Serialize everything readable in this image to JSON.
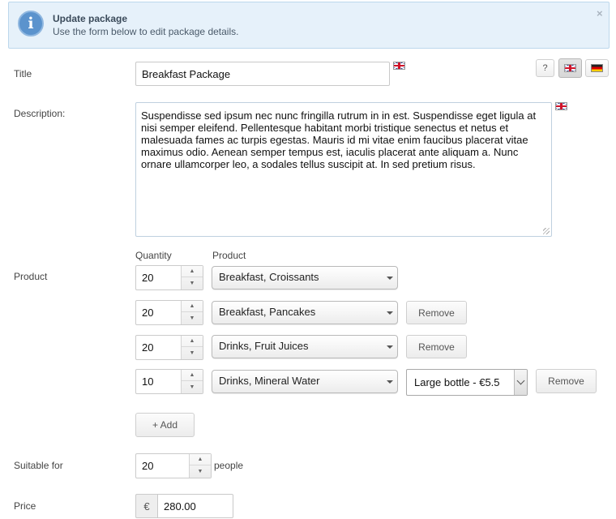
{
  "banner": {
    "icon": "info-icon",
    "title": "Update package",
    "subtitle": "Use the form below to edit package details.",
    "close": "×"
  },
  "toolbar": {
    "help_label": "?",
    "languages": [
      {
        "name": "en",
        "icon": "uk-flag-icon",
        "active": true
      },
      {
        "name": "de",
        "icon": "germany-flag-icon",
        "active": false
      }
    ]
  },
  "form": {
    "title_label": "Title",
    "title_value": "Breakfast Package",
    "description_label": "Description:",
    "description_value": "Suspendisse sed ipsum nec nunc fringilla rutrum in in est. Suspendisse eget ligula at nisi semper eleifend. Pellentesque habitant morbi tristique senectus et netus et malesuada fames ac turpis egestas. Mauris id mi vitae enim faucibus placerat vitae maximus odio. Aenean semper tempus est, iaculis placerat ante aliquam a. Nunc ornare ullamcorper leo, a sodales tellus suscipit at. In sed pretium risus.",
    "product_label": "Product",
    "quantity_header": "Quantity",
    "product_header": "Product",
    "products": [
      {
        "quantity": "20",
        "product": "Breakfast, Croissants",
        "remove": ""
      },
      {
        "quantity": "20",
        "product": "Breakfast, Pancakes",
        "remove": "Remove"
      },
      {
        "quantity": "20",
        "product": "Drinks, Fruit Juices",
        "remove": "Remove"
      },
      {
        "quantity": "10",
        "product": "Drinks, Mineral Water",
        "variant": "Large bottle - €5.5",
        "remove": "Remove"
      }
    ],
    "add_label": "+ Add",
    "suitable_label": "Suitable for",
    "suitable_value": "20",
    "suitable_unit": "people",
    "price_label": "Price",
    "price_currency": "€",
    "price_value": "280.00"
  },
  "colors": {
    "banner_bg": "#e6f1fa",
    "banner_border": "#bcd7ec",
    "info_icon": "#5b93cd"
  }
}
